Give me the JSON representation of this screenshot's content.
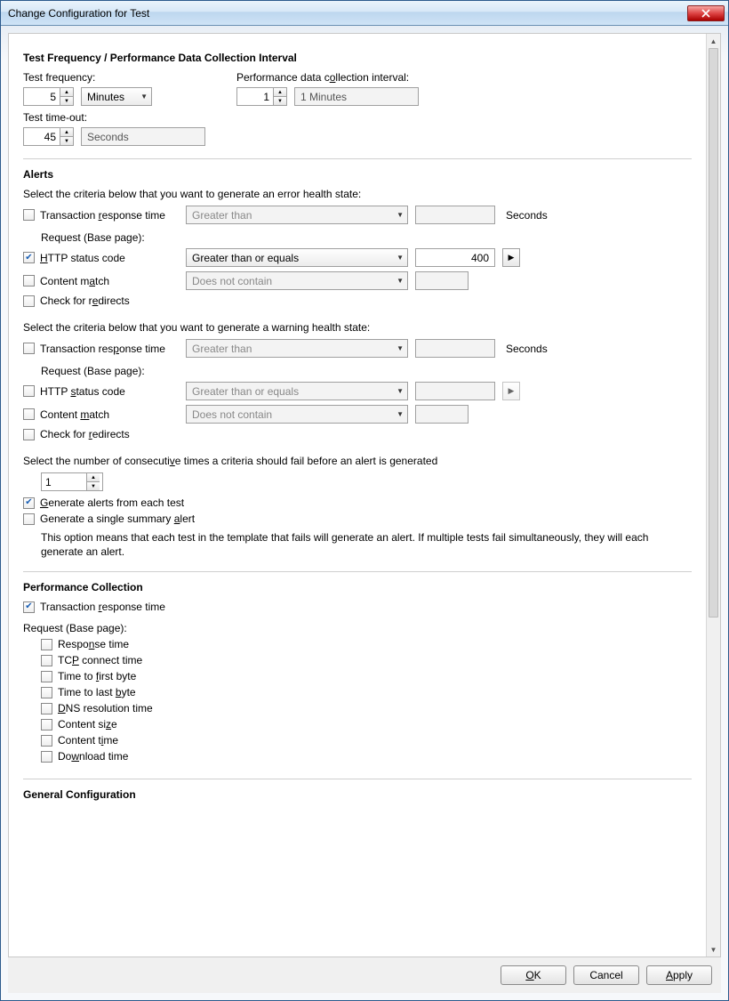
{
  "window": {
    "title": "Change Configuration for Test"
  },
  "section1": {
    "heading": "Test Frequency / Performance Data Collection Interval",
    "freq_label": "Test frequency:",
    "freq_value": "5",
    "freq_unit": "Minutes",
    "perf_label": "Performance data collection interval:",
    "perf_value": "1",
    "perf_display": "1 Minutes",
    "timeout_label": "Test time-out:",
    "timeout_value": "45",
    "timeout_unit": "Seconds"
  },
  "alerts": {
    "heading": "Alerts",
    "error_intro": "Select the criteria below that you want to generate an error health state:",
    "warn_intro": "Select the criteria below that you want to generate a warning health state:",
    "trt_label": "Transaction response time",
    "trt_op": "Greater than",
    "seconds": "Seconds",
    "req_label": "Request (Base page):",
    "http_label": "HTTP status code",
    "http_op": "Greater than or equals",
    "http_val": "400",
    "cm_label": "Content match",
    "cm_op": "Does not contain",
    "redir_label": "Check for redirects",
    "consec_label": "Select the number of consecutive times a criteria should fail before an alert is generated",
    "consec_val": "1",
    "gen_each": "Generate alerts from each test",
    "gen_single": "Generate a single summary alert",
    "desc": "This option means that each test in the template that fails will generate an alert. If multiple tests fail simultaneously, they will each generate an alert."
  },
  "perf": {
    "heading": "Performance Collection",
    "trt": "Transaction response time",
    "req_label": "Request (Base page):",
    "items": {
      "resp": "Response time",
      "tcp": "TCP connect time",
      "ttfb": "Time to first byte",
      "ttlb": "Time to last byte",
      "dns": "DNS resolution time",
      "csize": "Content size",
      "ctime": "Content time",
      "dl": "Download time"
    }
  },
  "general": {
    "heading": "General Configuration"
  },
  "buttons": {
    "ok": "OK",
    "cancel": "Cancel",
    "apply": "Apply"
  }
}
